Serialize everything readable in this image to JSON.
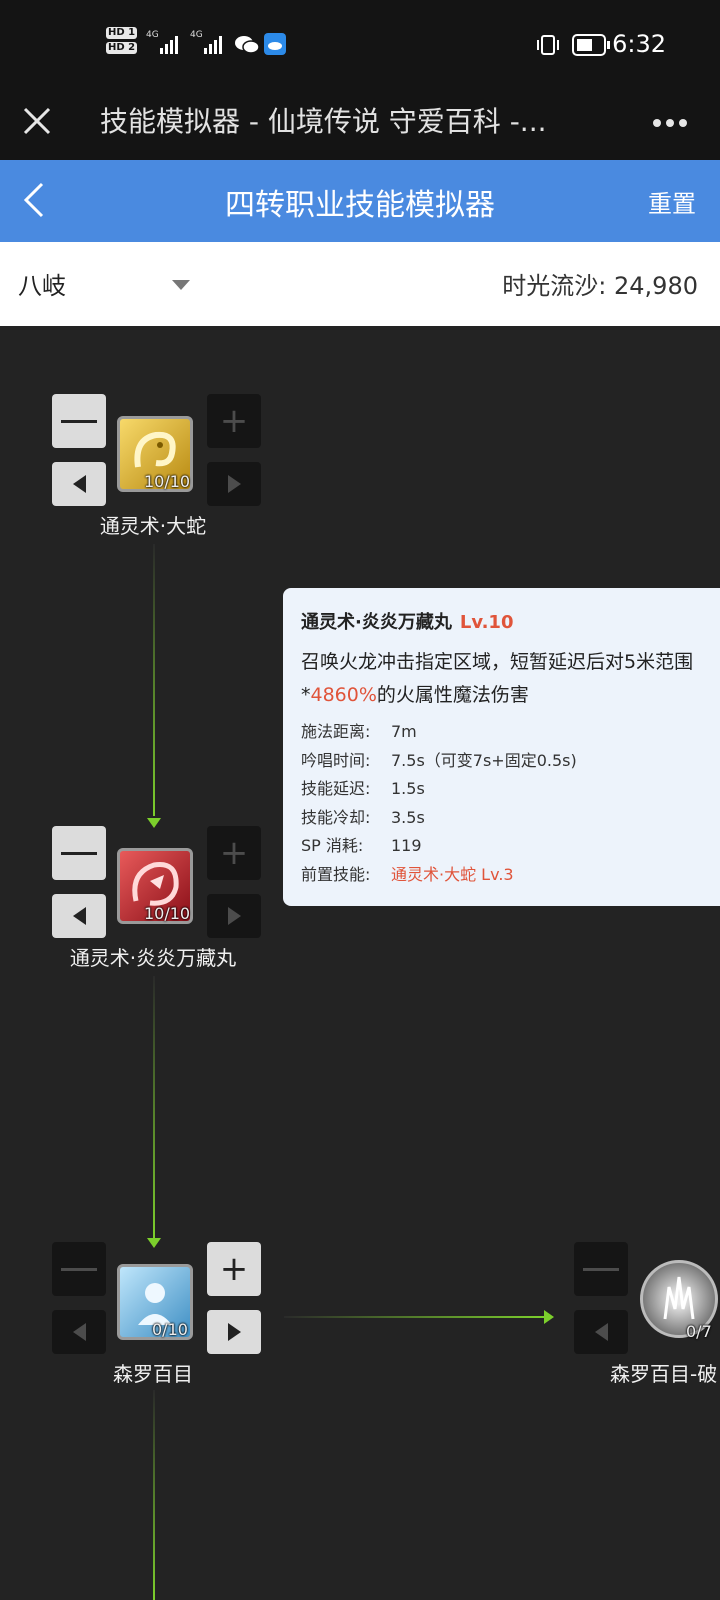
{
  "status_bar": {
    "hd1": "HD 1",
    "hd2": "HD 2",
    "net1": "4G",
    "net2": "4G",
    "time": "6:32"
  },
  "title_bar": {
    "title": "技能模拟器 - 仙境传说 守爱百科 -..."
  },
  "header": {
    "title": "四转职业技能模拟器",
    "reset_label": "重置"
  },
  "select_bar": {
    "class_name": "八岐",
    "sand_label": "时光流沙:",
    "sand_value": "24,980"
  },
  "skills": [
    {
      "name": "通灵术·大蛇",
      "level": "10/10"
    },
    {
      "name": "通灵术·炎炎万藏丸",
      "level": "10/10"
    },
    {
      "name": "森罗百目",
      "level": "0/10"
    },
    {
      "name": "森罗百目-破",
      "level": "0/7"
    }
  ],
  "tooltip": {
    "name": "通灵术·炎炎万藏丸",
    "lv": "Lv.10",
    "desc1": "召唤火龙冲击指定区域，短暂延迟后对5米范围",
    "desc2_prefix": "*",
    "desc2_highlight": "4860%",
    "desc2_suffix": "的火属性魔法伤害",
    "rows": [
      {
        "k": "施法距离:",
        "v": "7m"
      },
      {
        "k": "吟唱时间:",
        "v": "7.5s（可变7s+固定0.5s)"
      },
      {
        "k": "技能延迟:",
        "v": "1.5s"
      },
      {
        "k": "技能冷却:",
        "v": "3.5s"
      },
      {
        "k": "SP 消耗:",
        "v": "119"
      },
      {
        "k": "前置技能:",
        "v": "通灵术·大蛇 Lv.3"
      }
    ]
  },
  "colors": {
    "accent": "#4a8ae0",
    "link_line": "#7ccf2c",
    "highlight": "#e0543a"
  }
}
